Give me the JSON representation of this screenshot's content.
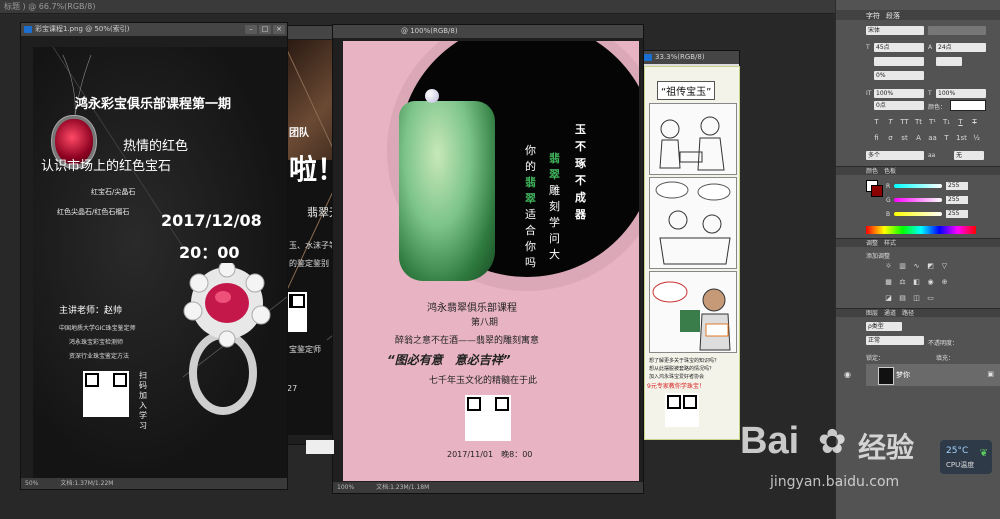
{
  "app": {
    "top_title": "标题 ) @ 66.7%(RGB/8)"
  },
  "windows": {
    "w1": {
      "title": "彩宝课程1.png @ 50%(索引)",
      "zoom": "50%",
      "doc": "文档:1.37M/1.22M"
    },
    "w2": {
      "title": "",
      "zoom": "",
      "doc": ""
    },
    "w3": {
      "title": "@ 100%(RGB/8)",
      "zoom": "100%",
      "doc": "文档:1.23M/1.18M"
    },
    "w4": {
      "title": "33.3%(RGB/8)",
      "zoom": "",
      "doc": ""
    }
  },
  "poster1": {
    "headline": "鸿永彩宝俱乐部课程第一期",
    "line1": "热情的红色",
    "line2": "认识市场上的红色宝石",
    "small1": "红宝石/尖晶石",
    "small2": "红色尖晶石/红色石榴石",
    "date": "2017/12/08",
    "time": "20：00",
    "teacher": "主讲老师：赵帅",
    "cred1": "中国地质大学GIC珠宝鉴定师",
    "cred2": "鸿永珠宝彩宝检测师",
    "cred3": "资深行业珠宝鉴定方法",
    "scan": "扫码加入学习"
  },
  "poster2": {
    "team": "团队",
    "big": "啦！",
    "tagline": "翡翠无处遁形",
    "line1": "玉、水沫子等",
    "line2": "的鉴定鉴别",
    "bottom": "宝鉴定师",
    "num": "27"
  },
  "poster3": {
    "col1": "玉不琢不成器",
    "col2": "翡翠雕刻学问大",
    "col3": "你的翡翠适合你吗",
    "club": "鸿永翡翠俱乐部课程",
    "period": "第八期",
    "sub": "醉翁之意不在酒——翡翠的雕刻寓意",
    "slogan": "“图必有意　意必吉祥”",
    "culture": "七千年玉文化的精髓在于此",
    "date": "2017/11/01　晚8：00"
  },
  "poster4": {
    "title": "“祖传宝玉”",
    "q1": "想了解更多关于珠宝的知识吗？",
    "q2": "想从此摆脱被套路的情况吗？",
    "q3": "加入鸿永珠宝爱好者协会",
    "q4": "9元专家教你学珠宝！"
  },
  "panel": {
    "tabs": [
      "字符",
      "段落"
    ],
    "font": "宋体",
    "size": "45点",
    "leading": "24点",
    "tracking": "0%",
    "scale_v": "100%",
    "scale_h": "100%",
    "baseline": "0点",
    "color_label": "颜色：",
    "aa_label": "多个",
    "aa_value": "无",
    "color_tabs": [
      "颜色",
      "色板"
    ],
    "r": "255",
    "g": "255",
    "b": "255",
    "adj_tabs": [
      "调整",
      "样式"
    ],
    "adj_title": "添加调整",
    "layer_tabs": [
      "图层",
      "通道",
      "路径"
    ],
    "kind": "ρ类型",
    "blend": "正常",
    "opacity_label": "不透明度：",
    "lock_label": "锁定：",
    "fill_label": "填充：",
    "layer_name": "梦你",
    "temp": "25°C",
    "temp_label": "CPU温度"
  },
  "watermark": {
    "brand": "Bai",
    "brand2": "经验",
    "url": "jingyan.baidu.com"
  },
  "colors": {
    "pink": "#e8b4c4",
    "green": "#3fae5a",
    "accent": "#1a6fd1"
  }
}
